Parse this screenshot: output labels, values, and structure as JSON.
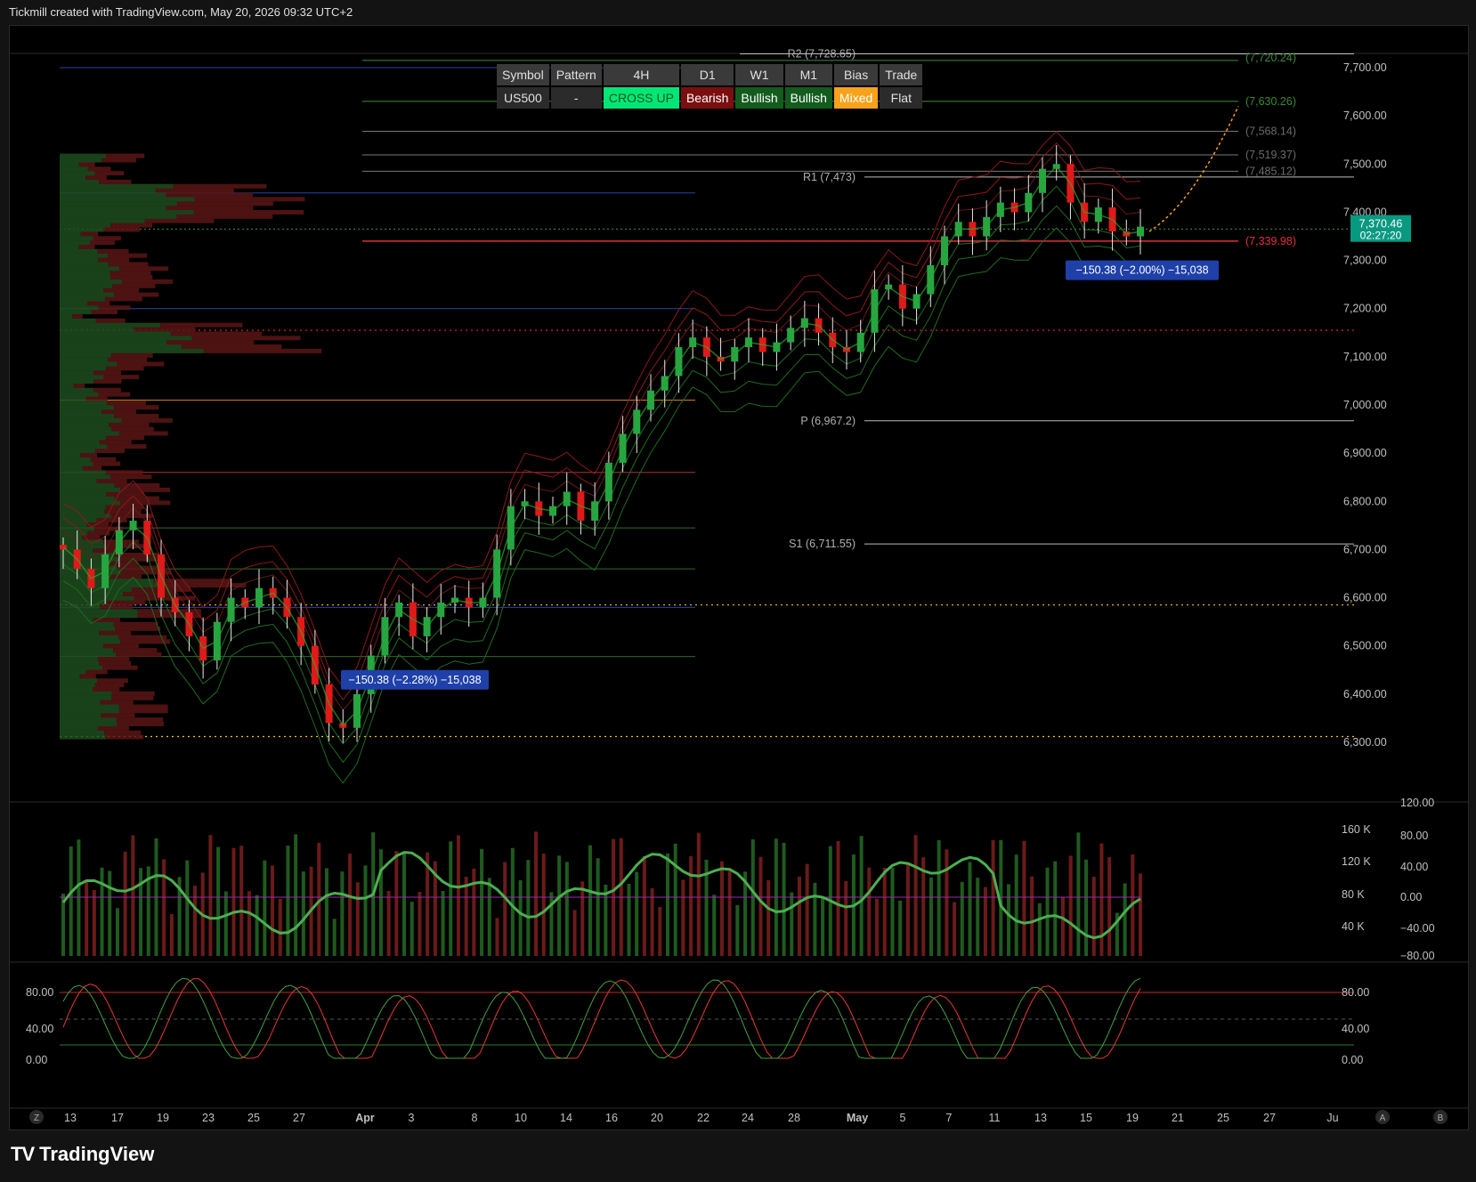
{
  "header": {
    "text": "Tickmill created with TradingView.com, May 20, 2026 09:32 UTC+2"
  },
  "footer": {
    "brand": "TradingView",
    "logo": "TV"
  },
  "colors": {
    "bull": "#26a641",
    "bear": "#e01919",
    "accent_green": "#00c853",
    "bg": "#000000"
  },
  "info_table": {
    "headers": [
      "Symbol",
      "Pattern",
      "4H",
      "D1",
      "W1",
      "M1",
      "Bias",
      "Trade"
    ],
    "values": [
      "US500",
      "-",
      "CROSS UP",
      "Bearish",
      "Bullish",
      "Bullish",
      "Mixed",
      "Flat"
    ],
    "value_colors": [
      "#2b2b2b",
      "#2b2b2b",
      "#00e676",
      "#7a0f0f",
      "#135c1e",
      "#135c1e",
      "#f7a21b",
      "#2b2b2b"
    ],
    "value_text_colors": [
      "#e0e0e0",
      "#e0e0e0",
      "#0c5a1f",
      "#ffffff",
      "#ffffff",
      "#ffffff",
      "#ffffff",
      "#e0e0e0"
    ]
  },
  "chart_data": [
    {
      "type": "candlestick",
      "symbol": "US500",
      "timeframe": "4H",
      "ylim": [
        6260,
        7740
      ],
      "y_ticks": [
        "7,700.00",
        "7,600.00",
        "7,500.00",
        "7,400.00",
        "7,300.00",
        "7,200.00",
        "7,100.00",
        "7,000.00",
        "6,900.00",
        "6,800.00",
        "6,700.00",
        "6,600.00",
        "6,500.00",
        "6,400.00",
        "6,300.00"
      ],
      "x_ticks": [
        "13",
        "17",
        "19",
        "23",
        "25",
        "27",
        "Apr",
        "3",
        "8",
        "10",
        "14",
        "16",
        "20",
        "22",
        "24",
        "28",
        "May",
        "5",
        "7",
        "11",
        "13",
        "15",
        "19",
        "21",
        "25",
        "27",
        "Ju"
      ],
      "last_price": "7,370.46",
      "countdown": "02:27:20",
      "pivot_levels": [
        {
          "label": "R2 (7,728.65)",
          "value": 7728.65
        },
        {
          "label": "R1 (7,473)",
          "value": 7473
        },
        {
          "label": "P (6,967.2)",
          "value": 6967.2
        },
        {
          "label": "S1 (6,711.55)",
          "value": 6711.55
        }
      ],
      "target_labels": [
        {
          "label": "(7,720.24)",
          "value": 7720.24,
          "color": "#3a8a3a"
        },
        {
          "label": "(7,630.26)",
          "value": 7630.26,
          "color": "#3a8a3a"
        },
        {
          "label": "(7,568.14)",
          "value": 7568.14,
          "color": "#6a6a6a"
        },
        {
          "label": "(7,519.37)",
          "value": 7519.37,
          "color": "#6a6a6a"
        },
        {
          "label": "(7,485.12)",
          "value": 7485.12,
          "color": "#6a6a6a"
        },
        {
          "label": "(7,339.98)",
          "value": 7339.98,
          "color": "#e0313a"
        }
      ],
      "measure_labels": [
        {
          "text": "−150.38 (−2.28%) −15,038"
        },
        {
          "text": "−150.38 (−2.00%) −15,038"
        }
      ],
      "close_series": [
        6700,
        6660,
        6620,
        6690,
        6740,
        6760,
        6690,
        6600,
        6570,
        6520,
        6470,
        6550,
        6600,
        6580,
        6620,
        6600,
        6560,
        6500,
        6420,
        6340,
        6330,
        6400,
        6480,
        6560,
        6590,
        6520,
        6560,
        6590,
        6600,
        6580,
        6600,
        6700,
        6790,
        6800,
        6770,
        6790,
        6820,
        6760,
        6800,
        6880,
        6940,
        6990,
        7030,
        7060,
        7120,
        7140,
        7100,
        7090,
        7120,
        7140,
        7110,
        7130,
        7160,
        7180,
        7150,
        7120,
        7110,
        7150,
        7240,
        7250,
        7200,
        7230,
        7290,
        7350,
        7380,
        7350,
        7390,
        7420,
        7400,
        7440,
        7490,
        7500,
        7420,
        7380,
        7410,
        7360,
        7350,
        7370
      ]
    },
    {
      "type": "bar",
      "name": "volume",
      "y_ticks": [
        "160 K",
        "120 K",
        "80 K",
        "40 K"
      ],
      "right_ticks": [
        "120.00",
        "80.00",
        "40.00",
        "0.00",
        "−40.00",
        "−80.00"
      ]
    },
    {
      "type": "line",
      "name": "stochastic",
      "y_ticks": [
        "80.00",
        "40.00",
        "0.00"
      ]
    }
  ],
  "toolbar": {
    "left_icon": "Z",
    "right_icon_a": "A",
    "right_icon_b": "B"
  }
}
